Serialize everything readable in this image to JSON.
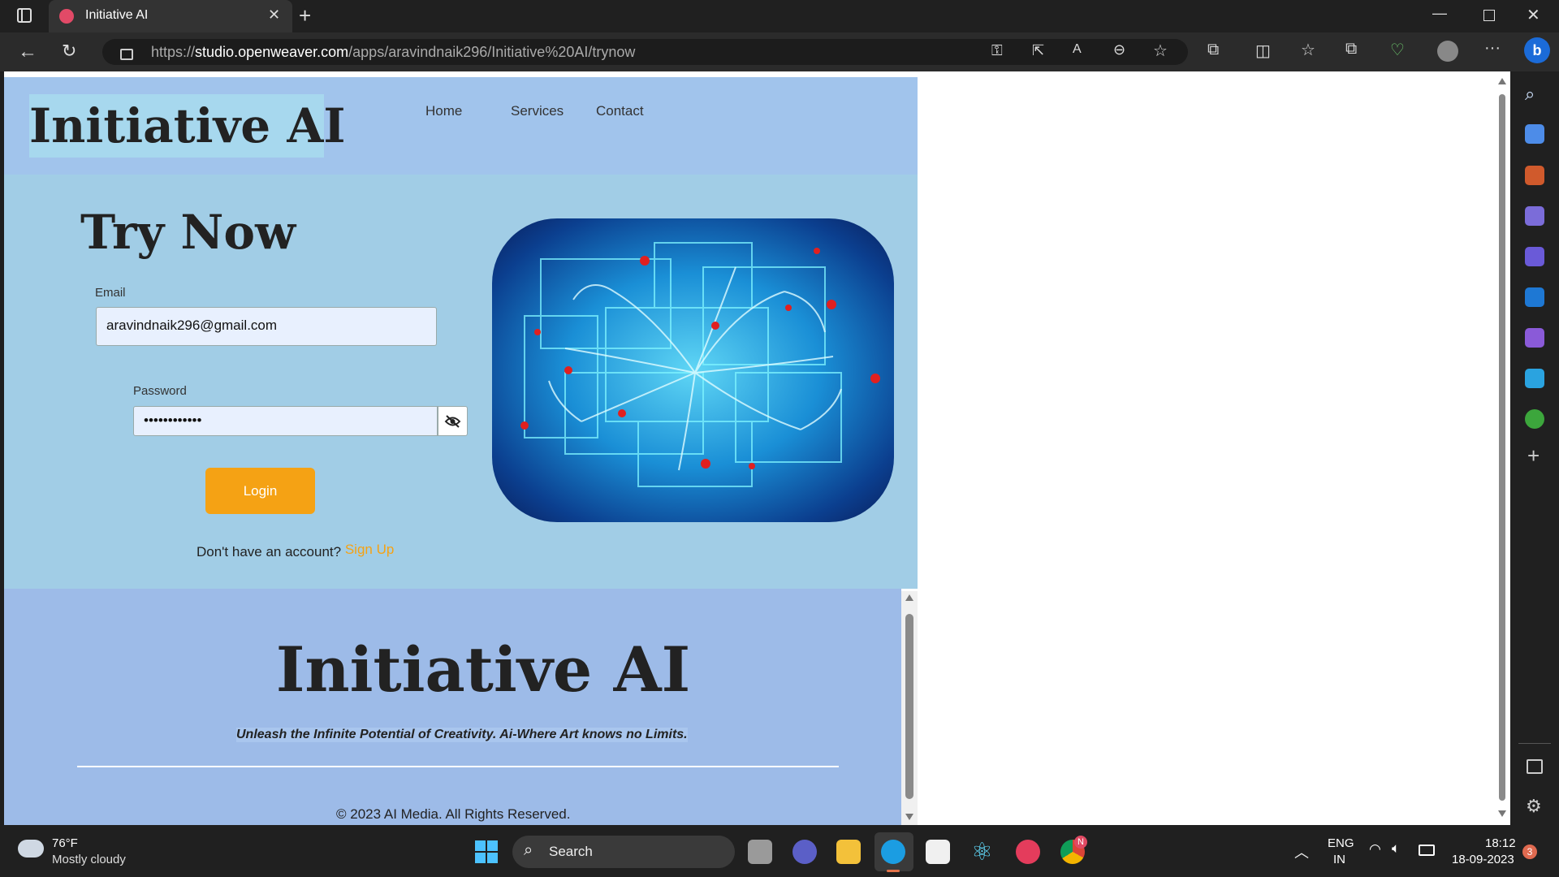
{
  "browser": {
    "tab_title": "Initiative AI",
    "url_prefix": "https://",
    "url_domain": "studio.openweaver.com",
    "url_path": "/apps/aravindnaik296/Initiative%20AI/trynow"
  },
  "page": {
    "header": {
      "logo": "Initiative AI",
      "nav": [
        "Home",
        "Services",
        "Contact"
      ]
    },
    "hero": {
      "title": "Try Now",
      "email_label": "Email",
      "email_value": "aravindnaik296@gmail.com",
      "password_label": "Password",
      "password_value": "••••••••••••",
      "login_label": "Login",
      "signup_prompt": "Don't have an account?",
      "signup_link": "Sign Up"
    },
    "footer": {
      "title": "Initiative AI",
      "tagline": "Unleash the Infinite Potential of Creativity. Ai-Where Art knows no Limits.",
      "copyright": "© 2023 AI Media. All Rights Reserved."
    }
  },
  "taskbar": {
    "weather_temp": "76°F",
    "weather_desc": "Mostly cloudy",
    "search_label": "Search",
    "lang_line1": "ENG",
    "lang_line2": "IN",
    "time": "18:12",
    "date": "18-09-2023",
    "notification_count": "3",
    "chrome_badge": "N"
  },
  "colors": {
    "header_bg": "#a1c4ec",
    "hero_bg": "#a1cde6",
    "footer_bg": "#9dbbe8",
    "accent_orange": "#f5a214"
  },
  "icons": {
    "browser": [
      "tab-actions-icon",
      "back-icon",
      "refresh-icon",
      "lock-icon",
      "key-icon",
      "share-icon",
      "read-aloud-icon",
      "zoom-icon",
      "favorite-icon",
      "extensions-icon",
      "split-screen-icon",
      "favorites-icon",
      "collections-icon",
      "performance-icon",
      "profile-icon",
      "more-icon",
      "bing-icon"
    ],
    "sidebar": [
      "search-icon",
      "shopping-icon",
      "tools-icon",
      "games-icon",
      "office-icon",
      "outlook-icon",
      "designer-icon",
      "telegram-icon",
      "tree-icon",
      "add-icon",
      "sidebar-toggle-icon",
      "settings-icon"
    ]
  }
}
